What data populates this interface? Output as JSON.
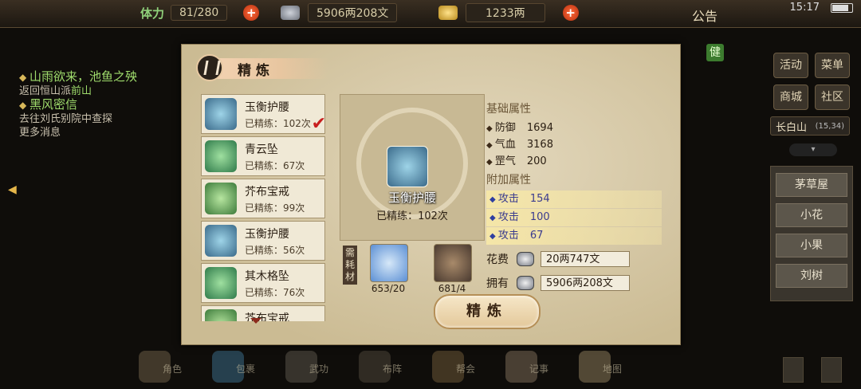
{
  "topbar": {
    "stamina_label": "体力",
    "stamina": "81/280",
    "copper": "5906两208文",
    "gold": "1233两",
    "notice": "公告",
    "clock": "15:17"
  },
  "quests": [
    {
      "title": "山雨欲来，池鱼之殃",
      "desc_prefix": "返回恒山派",
      "desc_highlight": "前山"
    },
    {
      "title": "黑风密信",
      "desc_lines": [
        "去往刘氏别院中查探",
        "更多消息"
      ]
    }
  ],
  "sidebar": {
    "jian": "健",
    "buttons": [
      "活动",
      "菜单",
      "商城",
      "社区"
    ],
    "location": "长白山",
    "coords": "(15,34)",
    "npcs": [
      "茅草屋",
      "小花",
      "小果",
      "刘树"
    ]
  },
  "dialog": {
    "title": "精炼",
    "items": [
      {
        "name": "玉衡护腰",
        "refine": "已精练：102次",
        "selected": true
      },
      {
        "name": "青云坠",
        "refine": "已精练：67次"
      },
      {
        "name": "芥布宝戒",
        "refine": "已精练：99次"
      },
      {
        "name": "玉衡护腰",
        "refine": "已精练：56次"
      },
      {
        "name": "其木格坠",
        "refine": "已精练：76次"
      },
      {
        "name": "芥布宝戒",
        "refine": ""
      }
    ],
    "selected": {
      "name": "玉衡护腰",
      "refine": "已精练：102次"
    },
    "base_attr_title": "基础属性",
    "base_attrs": [
      {
        "name": "防御",
        "value": "1694"
      },
      {
        "name": "气血",
        "value": "3168"
      },
      {
        "name": "罡气",
        "value": "200"
      }
    ],
    "extra_attr_title": "附加属性",
    "extra_attrs": [
      {
        "name": "攻击",
        "value": "154"
      },
      {
        "name": "攻击",
        "value": "100"
      },
      {
        "name": "攻击",
        "value": "67"
      }
    ],
    "materials_label": "需耗材",
    "materials": [
      {
        "count": "653/20",
        "color": "#5b8fd4"
      },
      {
        "count": "681/4",
        "color": "#4a3a30"
      }
    ],
    "cost_label": "花费",
    "cost_value": "20两747文",
    "own_label": "拥有",
    "own_value": "5906两208文",
    "refine_button": "精炼"
  },
  "bottombar": [
    "角色",
    "包裹",
    "武功",
    "布阵",
    "帮会",
    "记事",
    "地图"
  ],
  "colors": {
    "stamina_green": "#8fd07a",
    "panel_parchment": "#d5c7a3",
    "check_red": "#c81f1f"
  }
}
